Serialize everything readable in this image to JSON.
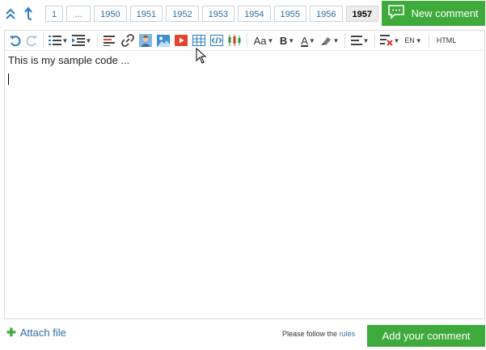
{
  "pagination": {
    "pages": [
      "1",
      "...",
      "1950",
      "1951",
      "1952",
      "1953",
      "1954",
      "1955",
      "1956"
    ],
    "current": "1957"
  },
  "new_comment": {
    "label": "New comment",
    "icon": "speech-bubble-icon"
  },
  "toolbar": {
    "text_size_label": "Aa",
    "bold_label": "B",
    "font_color_label": "A",
    "language_label": "EN",
    "html_label": "HTML"
  },
  "editor": {
    "content": "This is my sample code ..."
  },
  "footer": {
    "attach_label": "Attach file",
    "rules_prefix": "Please follow the",
    "rules_link": "rules",
    "add_comment_label": "Add your comment"
  },
  "colors": {
    "accent_green": "#3faa3c",
    "link_blue": "#2d6da8"
  }
}
